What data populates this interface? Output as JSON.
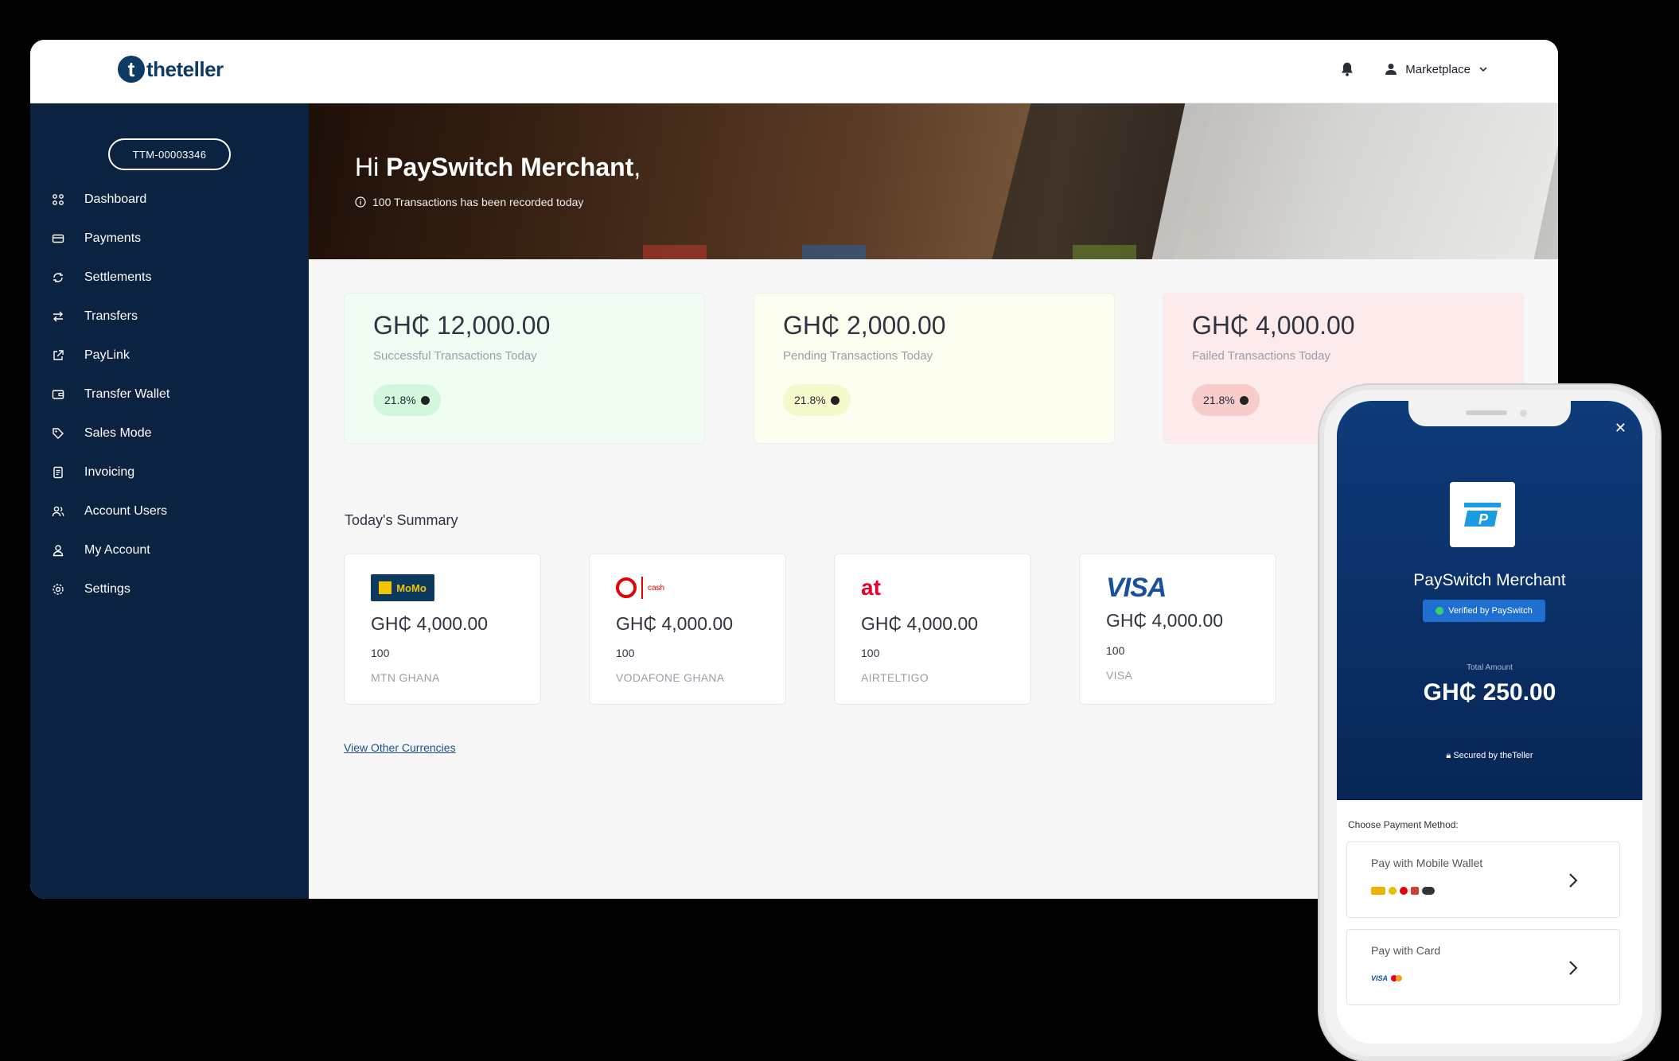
{
  "brand": {
    "logo_letter": "t",
    "logo_text": "theteller"
  },
  "topbar": {
    "account_label": "Marketplace"
  },
  "sidebar": {
    "merchant_id": "TTM-00003346",
    "items": [
      {
        "label": "Dashboard",
        "icon": "grid-icon"
      },
      {
        "label": "Payments",
        "icon": "card-icon"
      },
      {
        "label": "Settlements",
        "icon": "cycle-icon"
      },
      {
        "label": "Transfers",
        "icon": "transfer-arrows-icon"
      },
      {
        "label": "PayLink",
        "icon": "external-link-icon"
      },
      {
        "label": "Transfer Wallet",
        "icon": "wallet-icon"
      },
      {
        "label": "Sales Mode",
        "icon": "tag-icon"
      },
      {
        "label": "Invoicing",
        "icon": "document-icon"
      },
      {
        "label": "Account Users",
        "icon": "users-icon"
      },
      {
        "label": "My Account",
        "icon": "user-icon"
      },
      {
        "label": "Settings",
        "icon": "gear-icon"
      }
    ]
  },
  "hero": {
    "greeting": "Hi ",
    "merchant": "PaySwitch Merchant",
    "comma": ",",
    "subtitle": "100 Transactions has been recorded today"
  },
  "stats": [
    {
      "amount": "GH₵ 12,000.00",
      "label": "Successful Transactions Today",
      "pct": "21.8%",
      "bg": "#effdf3",
      "pill": "#d2f7dc"
    },
    {
      "amount": "GH₵ 2,000.00",
      "label": "Pending Transactions Today",
      "pct": "21.8%",
      "bg": "#fefef0",
      "pill": "#f7f9cc"
    },
    {
      "amount": "GH₵ 4,000.00",
      "label": "Failed Transactions Today",
      "pct": "21.8%",
      "bg": "#fdeaea",
      "pill": "#f9cccc"
    }
  ],
  "summary": {
    "title": "Today's Summary",
    "cards": [
      {
        "amount": "GH₵ 4,000.00",
        "count": "100",
        "name": "MTN GHANA",
        "logo": "mtn-momo-logo",
        "logo_text": "MoMo"
      },
      {
        "amount": "GH₵ 4,000.00",
        "count": "100",
        "name": "VODAFONE GHANA",
        "logo": "vodafone-cash-logo",
        "logo_text": "cash"
      },
      {
        "amount": "GH₵ 4,000.00",
        "count": "100",
        "name": "AIRTELTIGO",
        "logo": "airteltigo-logo",
        "logo_text": "at"
      },
      {
        "amount": "GH₵ 4,000.00",
        "count": "100",
        "name": "VISA",
        "logo": "visa-logo",
        "logo_text": "VISA"
      }
    ],
    "link": "View Other Currencies"
  },
  "phone": {
    "merchant": "PaySwitch Merchant",
    "verified": "Verified by PaySwitch",
    "total_label": "Total Amount",
    "total_amount": "GH₵ 250.00",
    "secured": "Secured by theTeller",
    "choose": "Choose Payment Method:",
    "methods": [
      {
        "label": "Pay with Mobile Wallet"
      },
      {
        "label": "Pay with Card",
        "icon_text": "VISA"
      }
    ]
  },
  "colors": {
    "navy": "#0b2341",
    "brand": "#0d3b66",
    "link": "#1b4f8a"
  }
}
